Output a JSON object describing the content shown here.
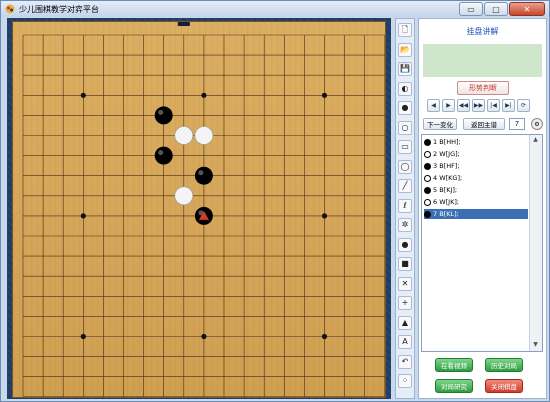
{
  "window": {
    "title": "少儿围棋教学对弈平台",
    "controls": {
      "minimize": "▭",
      "maximize": "□",
      "close": "✕"
    }
  },
  "board": {
    "size": 19,
    "grid_color": "#4a2e10",
    "black_stones": [
      [
        7,
        4
      ],
      [
        7,
        6
      ],
      [
        9,
        7
      ],
      [
        9,
        9
      ]
    ],
    "white_stones": [
      [
        8,
        5
      ],
      [
        9,
        5
      ],
      [
        8,
        8
      ]
    ],
    "last_move_marker": [
      9,
      9
    ],
    "star_points": [
      [
        3,
        3
      ],
      [
        9,
        3
      ],
      [
        15,
        3
      ],
      [
        3,
        9
      ],
      [
        9,
        9
      ],
      [
        15,
        9
      ],
      [
        3,
        15
      ],
      [
        9,
        15
      ],
      [
        15,
        15
      ]
    ],
    "top_marker": [
      8,
      -1
    ]
  },
  "toolbar": {
    "icons": [
      "new-file-icon",
      "open-file-icon",
      "save-icon",
      "black-white-icon",
      "black-stone-icon",
      "white-stone-icon",
      "rectangle-icon",
      "circle-icon",
      "line-icon",
      "lasso-icon",
      "settings-icon",
      "black-dot-icon",
      "black-square-icon",
      "cross-icon",
      "plus-icon",
      "triangle-icon",
      "text-icon",
      "undo-icon",
      "grid-icon"
    ],
    "glyphs": [
      "🗋",
      "📂",
      "💾",
      "◐",
      "●",
      "○",
      "▭",
      "◯",
      "╱",
      "ℓ",
      "✲",
      "●",
      "■",
      "✕",
      "+",
      "▲",
      "A",
      "↶",
      "⁘"
    ]
  },
  "panel": {
    "title": "挂盘讲解",
    "analysis_button": "形势判断",
    "nav_buttons": [
      "◀",
      "▶",
      "◀◀",
      "▶▶",
      "|◀",
      "▶|",
      "⟳"
    ],
    "next_variation": "下一变化",
    "back_main": "返回主谱",
    "move_count": "7",
    "moves": [
      {
        "color": "b",
        "text": "1 B[HH];"
      },
      {
        "color": "w",
        "text": "2 W[JG];"
      },
      {
        "color": "b",
        "text": "3 B[HF];"
      },
      {
        "color": "w",
        "text": "4 W[KG];"
      },
      {
        "color": "b",
        "text": "5 B[KJ];"
      },
      {
        "color": "w",
        "text": "6 W[JK];"
      },
      {
        "color": "b",
        "text": "7 B[KL];"
      }
    ],
    "selected_move": 6,
    "bottom_buttons": [
      "在看视频",
      "历史对局",
      "对局研究",
      "关闭棋盘"
    ]
  },
  "colors": {
    "board": "#d6a75a",
    "frame": "#1d3c66",
    "accent_red": "#d13a2a",
    "accent_green": "#2e9d41",
    "selection": "#3a6fb4"
  }
}
